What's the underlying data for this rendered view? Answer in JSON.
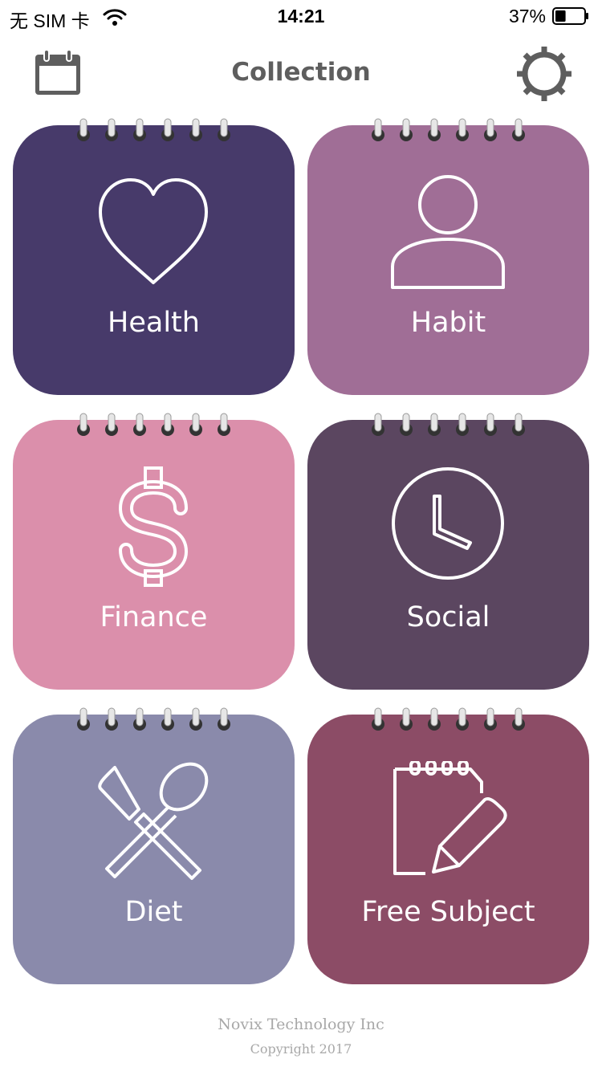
{
  "status_bar": {
    "carrier": "无 SIM 卡",
    "time": "14:21",
    "battery": "37%",
    "battery_level": 0.37
  },
  "nav": {
    "title": "Collection",
    "left_icon": "calendar-icon",
    "right_icon": "gear-icon"
  },
  "categories": [
    {
      "label": "Health",
      "icon": "heart-icon",
      "color": "#473a6a"
    },
    {
      "label": "Habit",
      "icon": "person-icon",
      "color": "#a06e96"
    },
    {
      "label": "Finance",
      "icon": "dollar-icon",
      "color": "#db8fab"
    },
    {
      "label": "Social",
      "icon": "clock-icon",
      "color": "#5b4660"
    },
    {
      "label": "Diet",
      "icon": "utensils-icon",
      "color": "#8a8aab"
    },
    {
      "label": "Free Subject",
      "icon": "notepad-pen-icon",
      "color": "#8c4c66"
    }
  ],
  "footer": {
    "company": "Novix Technology Inc",
    "copyright": "Copyright 2017"
  }
}
